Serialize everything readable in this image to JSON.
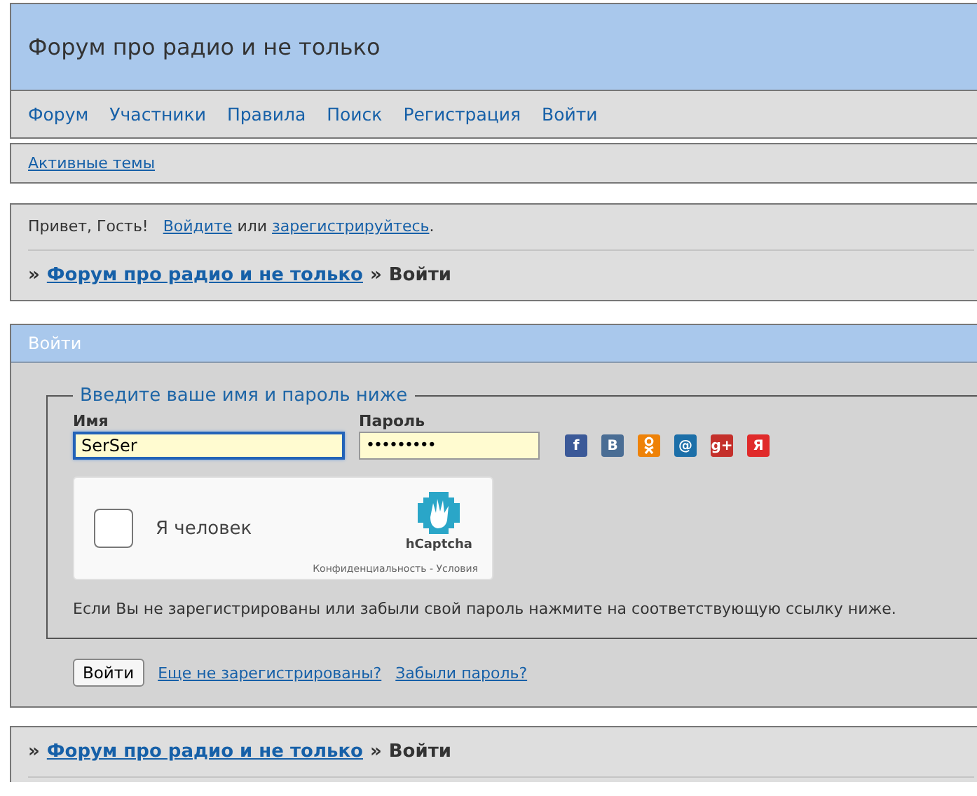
{
  "header": {
    "title": "Форум про радио и не только"
  },
  "nav": [
    {
      "label": "Форум"
    },
    {
      "label": "Участники"
    },
    {
      "label": "Правила"
    },
    {
      "label": "Поиск"
    },
    {
      "label": "Регистрация"
    },
    {
      "label": "Войти"
    }
  ],
  "subnav": [
    {
      "label": "Активные темы"
    }
  ],
  "welcome": {
    "greeting": "Привет, Гость!",
    "login_link": "Войдите",
    "or": "или",
    "register_link": "зарегистрируйтесь",
    "end": "."
  },
  "breadcrumbs_top": {
    "sep1": "»",
    "link": "Форум про радио и не только",
    "sep2": "»",
    "current": "Войти"
  },
  "login": {
    "title": "Войти",
    "legend": "Введите ваше имя и пароль ниже",
    "username": {
      "label": "Имя",
      "value": "SerSer",
      "focused": true
    },
    "password": {
      "label": "Пароль",
      "value": "•••••••••"
    },
    "socials": [
      {
        "kind": "letter",
        "glyph": "f",
        "color": "#3b5998"
      },
      {
        "kind": "letter",
        "glyph": "B",
        "color": "#4a6d94"
      },
      {
        "kind": "figure",
        "color": "#ee8208"
      },
      {
        "kind": "letter",
        "glyph": "@",
        "color": "#1c6fa8"
      },
      {
        "kind": "letter",
        "glyph": "g+",
        "color": "#c4302b"
      },
      {
        "kind": "letter",
        "glyph": "Я",
        "color": "#e02a2a"
      }
    ],
    "captcha": {
      "checked": false,
      "label": "Я человек",
      "brand": "hCaptcha",
      "links": "Конфиденциальность - Условия"
    },
    "note": "Если Вы не зарегистрированы или забыли свой пароль нажмите на соответствующую ссылку ниже.",
    "submit": "Войти",
    "links": [
      {
        "label": "Еще не зарегистрированы?"
      },
      {
        "label": "Забыли пароль?"
      }
    ]
  },
  "breadcrumbs_bottom": {
    "sep1": "»",
    "link": "Форум про радио и не только",
    "sep2": "»",
    "current": "Войти"
  }
}
